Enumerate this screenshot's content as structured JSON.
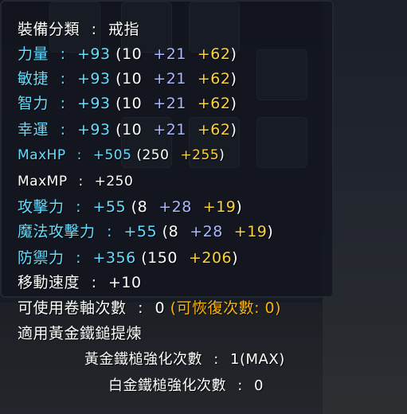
{
  "equip_category": {
    "label": "裝備分類",
    "value": "戒指"
  },
  "stats": [
    {
      "name": "力量",
      "total": "+93",
      "base": "10",
      "bonus_blue": "+21",
      "bonus_gold": "+62"
    },
    {
      "name": "敏捷",
      "total": "+93",
      "base": "10",
      "bonus_blue": "+21",
      "bonus_gold": "+62"
    },
    {
      "name": "智力",
      "total": "+93",
      "base": "10",
      "bonus_blue": "+21",
      "bonus_gold": "+62"
    },
    {
      "name": "幸運",
      "total": "+93",
      "base": "10",
      "bonus_blue": "+21",
      "bonus_gold": "+62"
    }
  ],
  "maxhp": {
    "name": "MaxHP",
    "total": "+505",
    "base": "250",
    "bonus_gold": "+255"
  },
  "maxmp": {
    "name": "MaxMP",
    "total": "+250"
  },
  "attack": {
    "name": "攻擊力",
    "total": "+55",
    "base": "8",
    "bonus_blue": "+28",
    "bonus_gold": "+19"
  },
  "magic_attack": {
    "name": "魔法攻擊力",
    "total": "+55",
    "base": "8",
    "bonus_blue": "+28",
    "bonus_gold": "+19"
  },
  "defense": {
    "name": "防禦力",
    "total": "+356",
    "base": "150",
    "bonus_gold": "+206"
  },
  "speed": {
    "name": "移動速度",
    "total": "+10"
  },
  "scroll": {
    "label": "可使用卷軸次數",
    "value": "0",
    "recover_text": "(可恢復次數: 0)"
  },
  "hammer_title": "適用黃金鐵鎚提煉",
  "gold_hammer": {
    "label": "黃金鐵槌強化次數",
    "value": "1(MAX)"
  },
  "platinum_hammer": {
    "label": "白金鐵槌強化次數",
    "value": "0"
  },
  "colors": {
    "stat_cyan": "#66ddff",
    "bonus_blue": "#aab8ff",
    "bonus_gold": "#ffd23a",
    "recover_orange": "#ffb400"
  }
}
